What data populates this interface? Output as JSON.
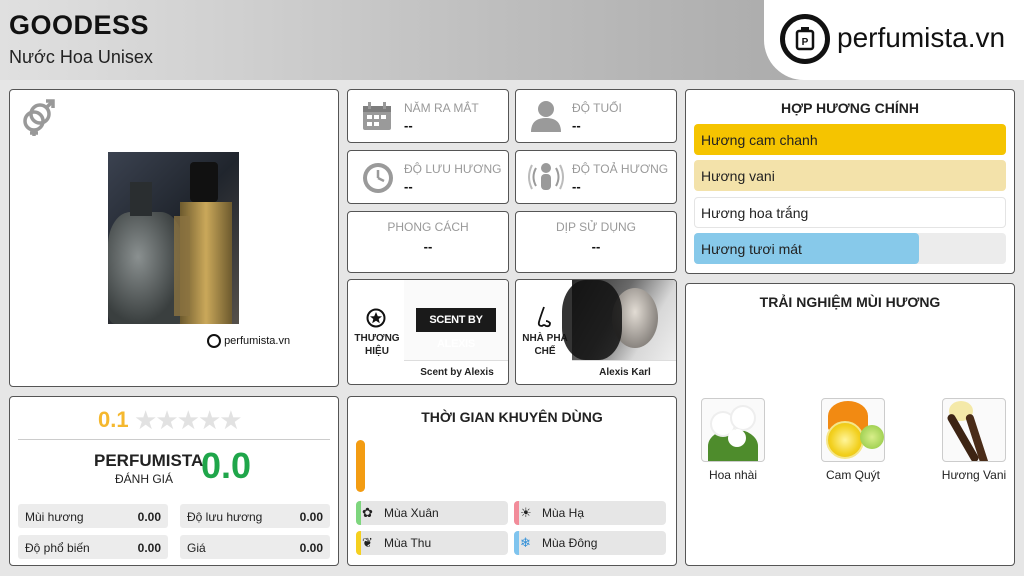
{
  "header": {
    "title": "GOODESS",
    "subtitle": "Nước Hoa Unisex",
    "logo_text": "perfumista.vn"
  },
  "product": {
    "watermark": "perfumista.vn",
    "gender_icon": "unisex-gender-icon"
  },
  "info": {
    "launch_year": {
      "label": "NĂM RA MẮT",
      "value": "--"
    },
    "age": {
      "label": "ĐỘ TUỔI",
      "value": "--"
    },
    "longevity": {
      "label": "ĐỘ LƯU HƯƠNG",
      "value": "--"
    },
    "sillage": {
      "label": "ĐỘ TOẢ HƯƠNG",
      "value": "--"
    },
    "style": {
      "label": "PHONG CÁCH",
      "value": "--"
    },
    "occasion": {
      "label": "DỊP SỬ DỤNG",
      "value": "--"
    }
  },
  "brand": {
    "label": "THƯƠNG HIỆU",
    "logo_text": "SCENT BY ALEXIS",
    "name": "Scent by Alexis"
  },
  "perfumer": {
    "label": "NHÀ PHA CHẾ",
    "name": "Alexis Karl"
  },
  "rating": {
    "user_score": "0.1",
    "stars": 0,
    "title": "PERFUMISTA",
    "subtitle": "ĐÁNH GIÁ",
    "score": "0.0",
    "stats": [
      {
        "label": "Mùi hương",
        "value": "0.00"
      },
      {
        "label": "Độ lưu hương",
        "value": "0.00"
      },
      {
        "label": "Độ phổ biến",
        "value": "0.00"
      },
      {
        "label": "Giá",
        "value": "0.00"
      }
    ]
  },
  "season": {
    "title": "THỜI GIAN KHUYÊN DÙNG",
    "day_night_level": 1.0,
    "items": [
      {
        "label": "Mùa Xuân",
        "color": "#7ed67e"
      },
      {
        "label": "Mùa Hạ",
        "color": "#f28c9a"
      },
      {
        "label": "Mùa Thu",
        "color": "#f5d020"
      },
      {
        "label": "Mùa Đông",
        "color": "#7fc4ee"
      }
    ]
  },
  "accords": {
    "title": "HỢP HƯƠNG CHÍNH",
    "items": [
      {
        "label": "Hương cam chanh",
        "level": 1.0,
        "color": "#f5c400"
      },
      {
        "label": "Hương vani",
        "level": 1.0,
        "color": "#f3e2aa"
      },
      {
        "label": "Hương hoa trắng",
        "level": 1.0,
        "color": "#ffffff"
      },
      {
        "label": "Hương tươi mát",
        "level": 0.72,
        "color": "#87c9ea"
      }
    ]
  },
  "notes": {
    "title": "TRẢI NGHIỆM MÙI HƯƠNG",
    "items": [
      {
        "label": "Hoa nhài"
      },
      {
        "label": "Cam Quýt"
      },
      {
        "label": "Hương Vani"
      }
    ]
  },
  "colors": {
    "accent_orange": "#f39c12",
    "score_green": "#1fa64a",
    "rating_yellow": "#f5b82e"
  }
}
